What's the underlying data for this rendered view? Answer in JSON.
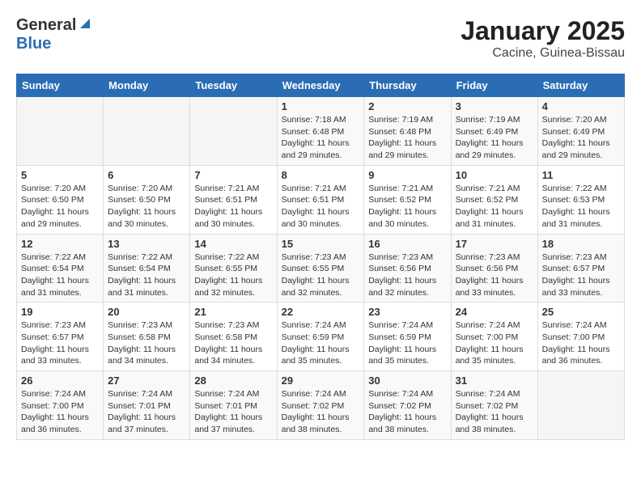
{
  "header": {
    "logo_general": "General",
    "logo_blue": "Blue",
    "title": "January 2025",
    "subtitle": "Cacine, Guinea-Bissau"
  },
  "weekdays": [
    "Sunday",
    "Monday",
    "Tuesday",
    "Wednesday",
    "Thursday",
    "Friday",
    "Saturday"
  ],
  "weeks": [
    [
      {
        "day": "",
        "info": ""
      },
      {
        "day": "",
        "info": ""
      },
      {
        "day": "",
        "info": ""
      },
      {
        "day": "1",
        "info": "Sunrise: 7:18 AM\nSunset: 6:48 PM\nDaylight: 11 hours\nand 29 minutes."
      },
      {
        "day": "2",
        "info": "Sunrise: 7:19 AM\nSunset: 6:48 PM\nDaylight: 11 hours\nand 29 minutes."
      },
      {
        "day": "3",
        "info": "Sunrise: 7:19 AM\nSunset: 6:49 PM\nDaylight: 11 hours\nand 29 minutes."
      },
      {
        "day": "4",
        "info": "Sunrise: 7:20 AM\nSunset: 6:49 PM\nDaylight: 11 hours\nand 29 minutes."
      }
    ],
    [
      {
        "day": "5",
        "info": "Sunrise: 7:20 AM\nSunset: 6:50 PM\nDaylight: 11 hours\nand 29 minutes."
      },
      {
        "day": "6",
        "info": "Sunrise: 7:20 AM\nSunset: 6:50 PM\nDaylight: 11 hours\nand 30 minutes."
      },
      {
        "day": "7",
        "info": "Sunrise: 7:21 AM\nSunset: 6:51 PM\nDaylight: 11 hours\nand 30 minutes."
      },
      {
        "day": "8",
        "info": "Sunrise: 7:21 AM\nSunset: 6:51 PM\nDaylight: 11 hours\nand 30 minutes."
      },
      {
        "day": "9",
        "info": "Sunrise: 7:21 AM\nSunset: 6:52 PM\nDaylight: 11 hours\nand 30 minutes."
      },
      {
        "day": "10",
        "info": "Sunrise: 7:21 AM\nSunset: 6:52 PM\nDaylight: 11 hours\nand 31 minutes."
      },
      {
        "day": "11",
        "info": "Sunrise: 7:22 AM\nSunset: 6:53 PM\nDaylight: 11 hours\nand 31 minutes."
      }
    ],
    [
      {
        "day": "12",
        "info": "Sunrise: 7:22 AM\nSunset: 6:54 PM\nDaylight: 11 hours\nand 31 minutes."
      },
      {
        "day": "13",
        "info": "Sunrise: 7:22 AM\nSunset: 6:54 PM\nDaylight: 11 hours\nand 31 minutes."
      },
      {
        "day": "14",
        "info": "Sunrise: 7:22 AM\nSunset: 6:55 PM\nDaylight: 11 hours\nand 32 minutes."
      },
      {
        "day": "15",
        "info": "Sunrise: 7:23 AM\nSunset: 6:55 PM\nDaylight: 11 hours\nand 32 minutes."
      },
      {
        "day": "16",
        "info": "Sunrise: 7:23 AM\nSunset: 6:56 PM\nDaylight: 11 hours\nand 32 minutes."
      },
      {
        "day": "17",
        "info": "Sunrise: 7:23 AM\nSunset: 6:56 PM\nDaylight: 11 hours\nand 33 minutes."
      },
      {
        "day": "18",
        "info": "Sunrise: 7:23 AM\nSunset: 6:57 PM\nDaylight: 11 hours\nand 33 minutes."
      }
    ],
    [
      {
        "day": "19",
        "info": "Sunrise: 7:23 AM\nSunset: 6:57 PM\nDaylight: 11 hours\nand 33 minutes."
      },
      {
        "day": "20",
        "info": "Sunrise: 7:23 AM\nSunset: 6:58 PM\nDaylight: 11 hours\nand 34 minutes."
      },
      {
        "day": "21",
        "info": "Sunrise: 7:23 AM\nSunset: 6:58 PM\nDaylight: 11 hours\nand 34 minutes."
      },
      {
        "day": "22",
        "info": "Sunrise: 7:24 AM\nSunset: 6:59 PM\nDaylight: 11 hours\nand 35 minutes."
      },
      {
        "day": "23",
        "info": "Sunrise: 7:24 AM\nSunset: 6:59 PM\nDaylight: 11 hours\nand 35 minutes."
      },
      {
        "day": "24",
        "info": "Sunrise: 7:24 AM\nSunset: 7:00 PM\nDaylight: 11 hours\nand 35 minutes."
      },
      {
        "day": "25",
        "info": "Sunrise: 7:24 AM\nSunset: 7:00 PM\nDaylight: 11 hours\nand 36 minutes."
      }
    ],
    [
      {
        "day": "26",
        "info": "Sunrise: 7:24 AM\nSunset: 7:00 PM\nDaylight: 11 hours\nand 36 minutes."
      },
      {
        "day": "27",
        "info": "Sunrise: 7:24 AM\nSunset: 7:01 PM\nDaylight: 11 hours\nand 37 minutes."
      },
      {
        "day": "28",
        "info": "Sunrise: 7:24 AM\nSunset: 7:01 PM\nDaylight: 11 hours\nand 37 minutes."
      },
      {
        "day": "29",
        "info": "Sunrise: 7:24 AM\nSunset: 7:02 PM\nDaylight: 11 hours\nand 38 minutes."
      },
      {
        "day": "30",
        "info": "Sunrise: 7:24 AM\nSunset: 7:02 PM\nDaylight: 11 hours\nand 38 minutes."
      },
      {
        "day": "31",
        "info": "Sunrise: 7:24 AM\nSunset: 7:02 PM\nDaylight: 11 hours\nand 38 minutes."
      },
      {
        "day": "",
        "info": ""
      }
    ]
  ]
}
